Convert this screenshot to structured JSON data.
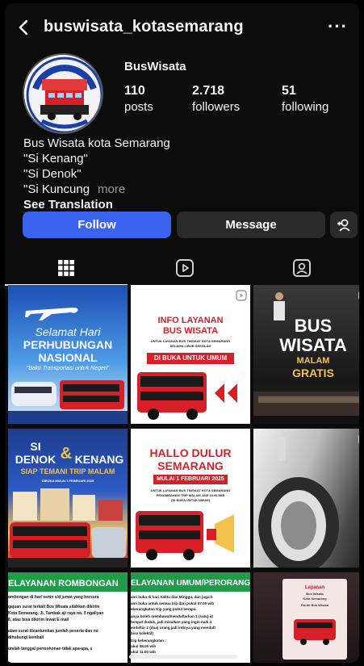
{
  "header": {
    "username": "buswisata_kotasemarang",
    "more_label": "···"
  },
  "profile": {
    "display_name": "BusWisata",
    "stats": [
      {
        "value": "110",
        "label": "posts"
      },
      {
        "value": "2.718",
        "label": "followers"
      },
      {
        "value": "51",
        "label": "following"
      }
    ],
    "bio_lines": [
      "Bus Wisata kota Semarang",
      "\"Si Kenang\"",
      "\"Si Denok\"",
      "\"Si Kuncung"
    ],
    "more_label": "more",
    "translation_label": "See Translation"
  },
  "actions": {
    "follow_label": "Follow",
    "message_label": "Message"
  },
  "tabs": [
    {
      "icon": "grid-icon"
    },
    {
      "icon": "reels-icon"
    },
    {
      "icon": "tagged-icon"
    }
  ],
  "posts": [
    {
      "lines": [
        "Selamat Hari",
        "PERHUBUNGAN",
        "NASIONAL",
        "\"Bakti Transportasi untuk Negeri\""
      ]
    },
    {
      "lines": [
        "INFO LAYANAN",
        "BUS WISATA",
        "UNTUK LAYANAN BUS TINGKAT KOTA SEMARANG",
        "SELAMA LIBUR SEKOLAH",
        "DI BUKA UNTUK UMUM"
      ]
    },
    {
      "lines": [
        "BUS",
        "WISATA",
        "MALAM",
        "GRATIS"
      ]
    },
    {
      "lines": [
        "SI",
        "DENOK",
        "&",
        "KENANG",
        "SIAP TEMANI TRIP MALAM",
        "DIBUKA MULAI 1 FEBRUARI 2025"
      ]
    },
    {
      "lines": [
        "HALLO DULUR",
        "SEMARANG",
        "MULAI 1 FEBRUARI 2025",
        "UNTUK LAYANAN BUS TINGKAT KOTA SEMARANG",
        "PENAMBAHAN TRIP MALAM JAM 18.00 WIB",
        "(DI BUKA UNTUK UMUM)"
      ]
    },
    {
      "lines": []
    },
    {
      "lines": [
        "ELAYANAN ROMBONGAN",
        "ombongan di hari senin s/d jumat yang bersura",
        "gajuan surat terkait Bus Wisata silahkan dikirim",
        "Kota Semarang, Jl. Tambak aji raya no. 5 ngaliyan",
        "8, atau bisa dikirim lewat E-mail",
        "alam surat dicantumkan jumlah peserta dan no",
        "dihubungi kembali",
        "umlah tanggal permohonan tidak apa-apa, s"
      ]
    },
    {
      "lines": [
        "ELAYANAN UMUM/PERORANGA",
        "ami buka di hari Sabtu dan Minggu, dan juga h",
        "ami buka untuk semua trip dari pukul 07.00 wib",
        "eberangkatan trip yang pukul berapa.",
        "anya boleh membawa/mendaftarkan 1 (satu) id",
        "tempat duduk, jadi misalkan yang ingin naik 4",
        "endaftar 2 (dua) orang jadi intinya yang mendaft",
        "bisa kolektif)",
        "trip keberangkatan :",
        "ukul 08.00 wib",
        "ukul 11.00 wib"
      ]
    },
    {
      "lines": [
        "Layanan",
        "Bus Wisata",
        "Kota Semarang",
        "Route Bus Wisata"
      ]
    }
  ],
  "colors": {
    "accent": "#3a63f0",
    "brand_red": "#d61f26",
    "dark": "#0c0c0c",
    "green": "#1f9b4a"
  }
}
